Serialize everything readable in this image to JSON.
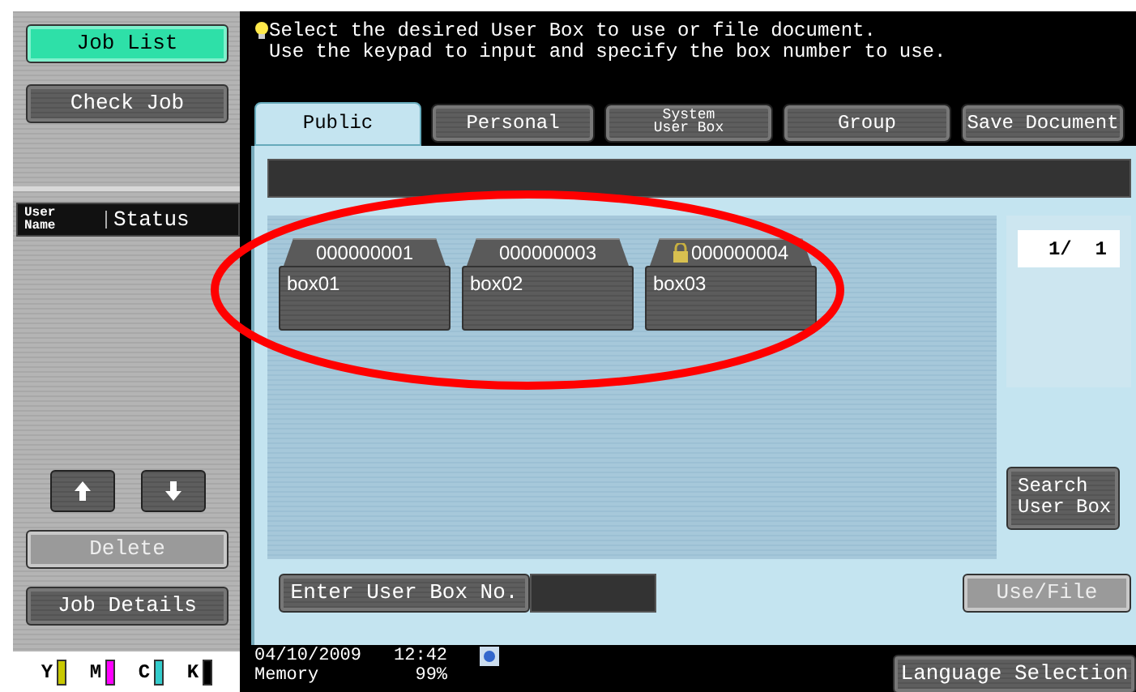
{
  "sidebar": {
    "buttons": [
      {
        "label": "Job List",
        "selected": true
      },
      {
        "label": "Check Job",
        "selected": false
      }
    ],
    "columns": [
      "User\nName",
      "Status"
    ],
    "actions": [
      {
        "label": "Delete",
        "disabled": true
      },
      {
        "label": "Job Details",
        "disabled": false
      }
    ],
    "toner": [
      {
        "label": "Y",
        "color": "#c8c800"
      },
      {
        "label": "M",
        "color": "#ff00ff"
      },
      {
        "label": "C",
        "color": "#33cccc"
      },
      {
        "label": "K",
        "color": "#000000"
      }
    ]
  },
  "message": [
    "Select the desired User Box to use or file document.",
    "Use the keypad to input and specify the box number to use."
  ],
  "tabs": [
    {
      "label": "Public",
      "selected": true
    },
    {
      "label": "Personal",
      "selected": false
    },
    {
      "label": "System\nUser Box",
      "selected": false
    },
    {
      "label": "Group",
      "selected": false
    },
    {
      "label": "Save Document",
      "selected": false
    }
  ],
  "boxes": [
    {
      "number": "000000001",
      "name": "box01",
      "locked": false
    },
    {
      "number": "000000003",
      "name": "box02",
      "locked": false
    },
    {
      "number": "000000004",
      "name": "box03",
      "locked": true
    }
  ],
  "page": "1/  1",
  "search_button": "Search\nUser Box",
  "enter_box_button": "Enter User Box No.",
  "use_file_button": {
    "label": "Use/File",
    "disabled": true
  },
  "status_bar": {
    "date": "04/10/2009",
    "time": "12:42",
    "memory_label": "Memory",
    "memory": "99%",
    "language_button": "Language Selection"
  },
  "annotation": {
    "color": "#ff0000"
  }
}
